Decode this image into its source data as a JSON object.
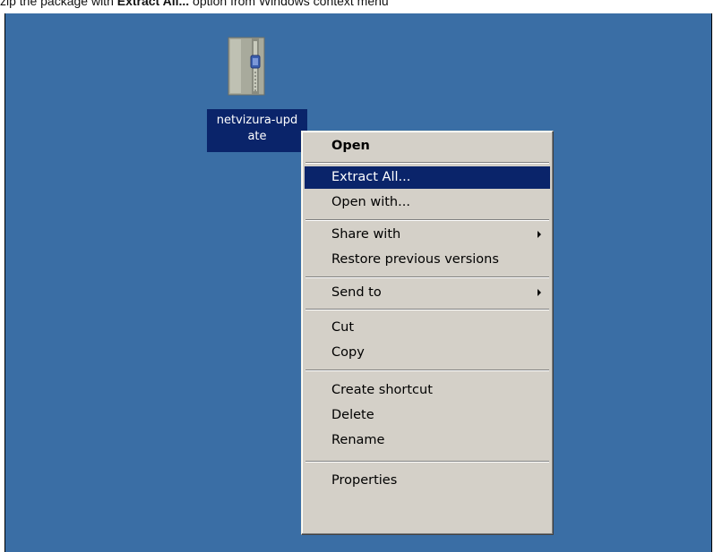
{
  "caption": {
    "prefix": "zip the package with ",
    "bold": "Extract All...",
    "suffix": " option from Windows context menu"
  },
  "desktop": {
    "background": "#3a6ea5",
    "icon": {
      "name": "zip-folder-icon",
      "label_line1": "netvizura-upd",
      "label_line2": "ate"
    }
  },
  "context_menu": {
    "items": [
      {
        "label": "Open",
        "bold": true
      },
      {
        "label": "Extract All...",
        "highlighted": true
      },
      {
        "label": "Open with..."
      },
      {
        "label": "Share with",
        "submenu": true
      },
      {
        "label": "Restore previous versions"
      },
      {
        "label": "Send to",
        "submenu": true
      },
      {
        "label": "Cut"
      },
      {
        "label": "Copy"
      },
      {
        "label": "Create shortcut"
      },
      {
        "label": "Delete"
      },
      {
        "label": "Rename"
      },
      {
        "label": "Properties"
      }
    ],
    "highlight_color": "#0a246a",
    "background": "#d4d0c8"
  }
}
